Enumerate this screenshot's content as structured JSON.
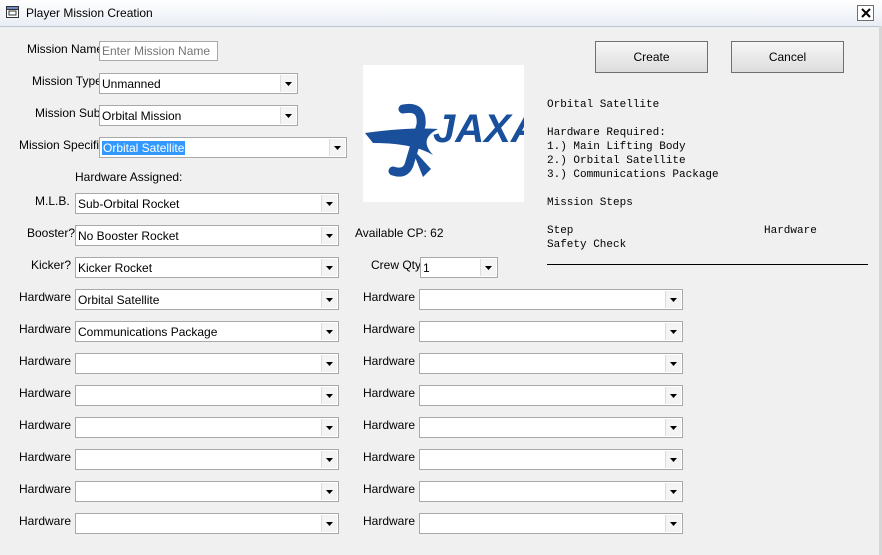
{
  "window": {
    "title": "Player Mission Creation"
  },
  "form": {
    "mission_name_label": "Mission Name:",
    "mission_name_placeholder": "Enter Mission Name",
    "mission_type_label": "Mission Type:",
    "mission_type_value": "Unmanned",
    "mission_sub_label": "Mission Sub:",
    "mission_sub_value": "Orbital Mission",
    "mission_specific_label": "Mission Specific:",
    "mission_specific_value": "Orbital Satellite",
    "hardware_assigned_label": "Hardware Assigned:",
    "mlb_label": "M.L.B.",
    "mlb_value": "Sub-Orbital Rocket",
    "booster_label": "Booster?",
    "booster_value": "No Booster Rocket",
    "kicker_label": "Kicker?",
    "kicker_value": "Kicker Rocket",
    "available_cp": "Available CP: 62",
    "crew_qty_label": "Crew Qty",
    "crew_qty_value": "1",
    "hardware_label": "Hardware",
    "hardware_left": [
      "Orbital Satellite",
      "Communications Package",
      "",
      "",
      "",
      "",
      "",
      ""
    ],
    "hardware_right": [
      "",
      "",
      "",
      "",
      "",
      "",
      "",
      ""
    ]
  },
  "buttons": {
    "create": "Create",
    "cancel": "Cancel"
  },
  "logo": {
    "text": "JAXA",
    "color": "#1a4f9c"
  },
  "info": {
    "mission_title": "Orbital Satellite",
    "hardware_required_heading": "Hardware Required:",
    "hardware_required": [
      "1.) Main Lifting Body",
      "2.) Orbital Satellite",
      "3.) Communications Package"
    ],
    "mission_steps_heading": "Mission Steps",
    "step_col": "Step",
    "hardware_col": "Hardware",
    "steps": [
      "Safety Check"
    ]
  },
  "colors": {
    "selection": "#3399ff",
    "window_bg": "#f0f0f0"
  }
}
